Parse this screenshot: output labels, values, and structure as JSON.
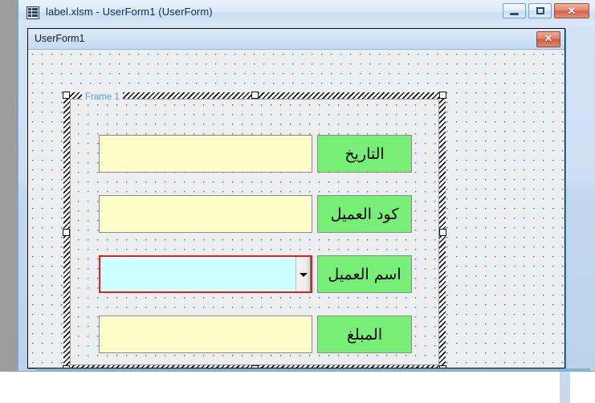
{
  "window": {
    "title": "label.xlsm - UserForm1 (UserForm)",
    "icon": "excel-userform-icon",
    "controls": {
      "minimize_label": "–",
      "maximize_label": "□",
      "close_label": "✕"
    }
  },
  "userform": {
    "title": "UserForm1",
    "close_label": "✕",
    "frame": {
      "caption": "Frame 1",
      "selected": true
    },
    "rows": [
      {
        "label": "التاريخ",
        "control_type": "textbox",
        "value": "",
        "fill": "#FFFFCC"
      },
      {
        "label": "كود العميل",
        "control_type": "textbox",
        "value": "",
        "fill": "#FFFFCC"
      },
      {
        "label": "اسم العميل",
        "control_type": "combobox",
        "value": "",
        "fill": "#CCFFFF",
        "selected": true
      },
      {
        "label": "المبلغ",
        "control_type": "textbox",
        "value": "",
        "fill": "#FFFFCC"
      }
    ]
  },
  "colors": {
    "label_green": "#77EF77",
    "textbox_yellow": "#FFFFCC",
    "combo_cyan": "#CCFFFF",
    "selection_red": "#E02020",
    "grid_dot_blue": "#2D7FD4",
    "frame_caption_blue": "#4EA1E6"
  }
}
